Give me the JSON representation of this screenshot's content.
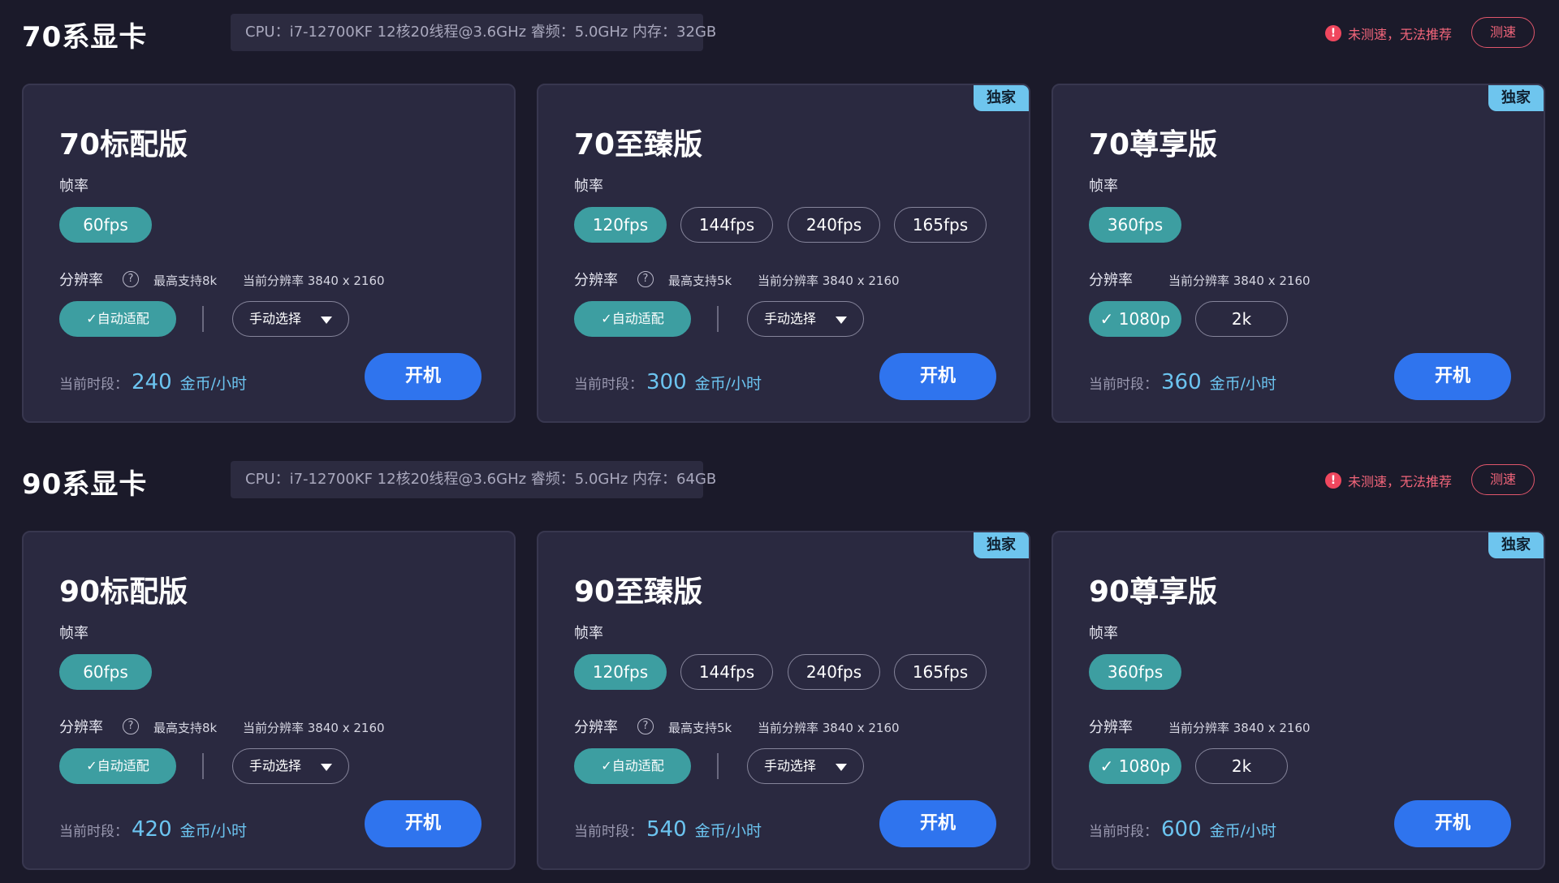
{
  "colors": {
    "background": "#1b1a2a",
    "card": "#2a2940",
    "accent_teal": "#3d9ea1",
    "accent_blue": "#2f74ee",
    "price_blue": "#6cc4f0",
    "warn_red": "#f2657a",
    "badge": "#6ec5ee"
  },
  "sections": [
    {
      "title": "70系显卡",
      "cpu_info": "CPU：i7-12700KF 12核20线程@3.6GHz 睿频：5.0GHz 内存：32GB",
      "warning_icon": "!",
      "warning": "未测速，无法推荐",
      "test_button": "测速",
      "cards": [
        {
          "title": "70标配版",
          "fps_label": "帧率",
          "fps": [
            {
              "label": "60fps",
              "selected": true
            }
          ],
          "res_label": "分辨率",
          "help_icon": "?",
          "max_support": "最高支持8k",
          "current_res": "当前分辨率 3840 x 2160",
          "auto_label": "✓自动适配",
          "manual_label": "手动选择",
          "price_prefix": "当前时段：",
          "price": "240",
          "price_unit": "金币/小时",
          "boot_label": "开机"
        },
        {
          "badge": "独家",
          "title": "70至臻版",
          "fps_label": "帧率",
          "fps": [
            {
              "label": "120fps",
              "selected": true
            },
            {
              "label": "144fps",
              "selected": false
            },
            {
              "label": "240fps",
              "selected": false
            },
            {
              "label": "165fps",
              "selected": false
            }
          ],
          "res_label": "分辨率",
          "help_icon": "?",
          "max_support": "最高支持5k",
          "current_res": "当前分辨率 3840 x 2160",
          "auto_label": "✓自动适配",
          "manual_label": "手动选择",
          "price_prefix": "当前时段：",
          "price": "300",
          "price_unit": "金币/小时",
          "boot_label": "开机"
        },
        {
          "badge": "独家",
          "title": "70尊享版",
          "fps_label": "帧率",
          "fps": [
            {
              "label": "360fps",
              "selected": true
            }
          ],
          "res_label": "分辨率",
          "current_res": "当前分辨率 3840 x 2160",
          "res_options": [
            {
              "label": "✓ 1080p",
              "selected": true
            },
            {
              "label": "2k",
              "selected": false
            }
          ],
          "price_prefix": "当前时段：",
          "price": "360",
          "price_unit": "金币/小时",
          "boot_label": "开机"
        }
      ]
    },
    {
      "title": "90系显卡",
      "cpu_info": "CPU：i7-12700KF 12核20线程@3.6GHz 睿频：5.0GHz 内存：64GB",
      "warning_icon": "!",
      "warning": "未测速，无法推荐",
      "test_button": "测速",
      "cards": [
        {
          "title": "90标配版",
          "fps_label": "帧率",
          "fps": [
            {
              "label": "60fps",
              "selected": true
            }
          ],
          "res_label": "分辨率",
          "help_icon": "?",
          "max_support": "最高支持8k",
          "current_res": "当前分辨率 3840 x 2160",
          "auto_label": "✓自动适配",
          "manual_label": "手动选择",
          "price_prefix": "当前时段：",
          "price": "420",
          "price_unit": "金币/小时",
          "boot_label": "开机"
        },
        {
          "badge": "独家",
          "title": "90至臻版",
          "fps_label": "帧率",
          "fps": [
            {
              "label": "120fps",
              "selected": true
            },
            {
              "label": "144fps",
              "selected": false
            },
            {
              "label": "240fps",
              "selected": false
            },
            {
              "label": "165fps",
              "selected": false
            }
          ],
          "res_label": "分辨率",
          "help_icon": "?",
          "max_support": "最高支持5k",
          "current_res": "当前分辨率 3840 x 2160",
          "auto_label": "✓自动适配",
          "manual_label": "手动选择",
          "price_prefix": "当前时段：",
          "price": "540",
          "price_unit": "金币/小时",
          "boot_label": "开机"
        },
        {
          "badge": "独家",
          "title": "90尊享版",
          "fps_label": "帧率",
          "fps": [
            {
              "label": "360fps",
              "selected": true
            }
          ],
          "res_label": "分辨率",
          "current_res": "当前分辨率 3840 x 2160",
          "res_options": [
            {
              "label": "✓ 1080p",
              "selected": true
            },
            {
              "label": "2k",
              "selected": false
            }
          ],
          "price_prefix": "当前时段：",
          "price": "600",
          "price_unit": "金币/小时",
          "boot_label": "开机"
        }
      ]
    }
  ]
}
